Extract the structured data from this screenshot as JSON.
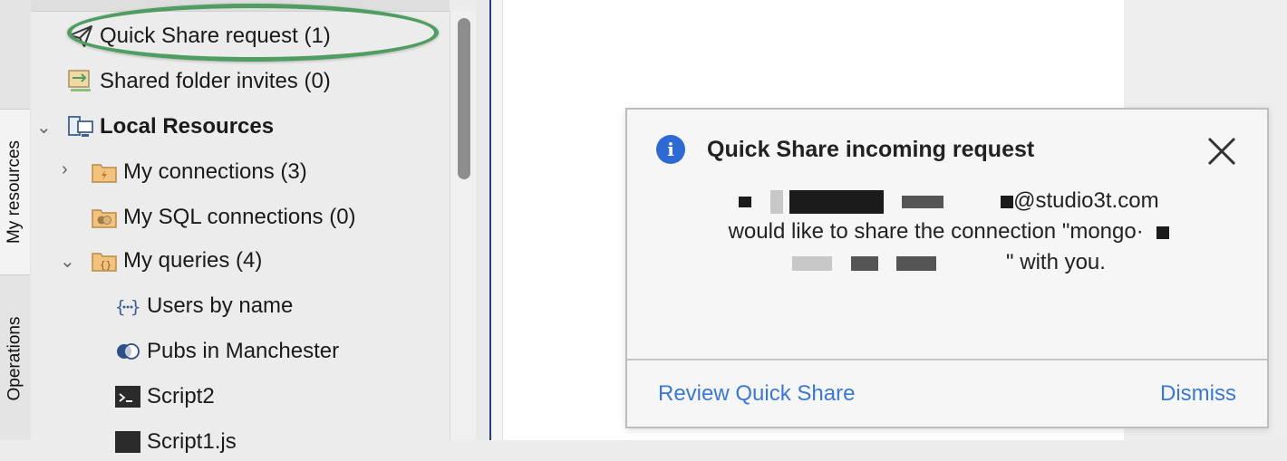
{
  "side_tabs": {
    "resources": "My resources",
    "operations": "Operations"
  },
  "tree": {
    "items": [
      {
        "label": "Quick Share request (1)",
        "icon": "paper-plane-icon"
      },
      {
        "label": "Shared folder invites (0)",
        "icon": "shared-folder-icon"
      },
      {
        "label": "Local Resources",
        "icon": "computer-icon"
      },
      {
        "label": "My connections (3)",
        "icon": "connections-folder-icon"
      },
      {
        "label": "My SQL connections (0)",
        "icon": "sql-folder-icon"
      },
      {
        "label": "My queries (4)",
        "icon": "queries-folder-icon"
      },
      {
        "label": "Users by name",
        "icon": "query-braces-icon"
      },
      {
        "label": "Pubs in Manchester",
        "icon": "venn-query-icon"
      },
      {
        "label": "Script2",
        "icon": "terminal-icon"
      },
      {
        "label": "Script1.js",
        "icon": "terminal-icon"
      }
    ]
  },
  "notification": {
    "title": "Quick Share incoming request",
    "email_suffix": "@studio3t.com",
    "line2": "would like to share the connection \"mongo·",
    "line3_suffix": "\" with you.",
    "review_label": "Review Quick Share",
    "dismiss_label": "Dismiss"
  },
  "colors": {
    "highlight": "#4f9d60",
    "link": "#3a78d2",
    "info": "#2f6ad2"
  }
}
